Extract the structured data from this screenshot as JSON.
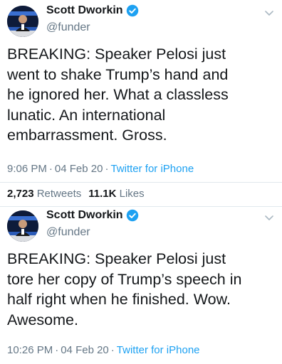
{
  "tweets": [
    {
      "display_name": "Scott Dworkin",
      "handle": "@funder",
      "text": "BREAKING: Speaker Pelosi just\nwent to shake Trump’s hand and\nhe ignored her. What a classless\nlunatic. An international\nembarrassment. Gross.",
      "time": "9:06 PM",
      "date": "04 Feb 20",
      "source": "Twitter for iPhone",
      "retweets": "2,723",
      "retweets_label": "Retweets",
      "likes": "11.1K",
      "likes_label": "Likes"
    },
    {
      "display_name": "Scott Dworkin",
      "handle": "@funder",
      "text": "BREAKING: Speaker Pelosi just\ntore her copy of Trump’s speech in\nhalf right when he finished. Wow.\nAwesome.",
      "time": "10:26 PM",
      "date": "04 Feb 20",
      "source": "Twitter for iPhone"
    }
  ],
  "meta_separator": "·",
  "colors": {
    "verified_badge": "#1da1f2",
    "source_link": "#1da1f2",
    "secondary_text": "#657786"
  },
  "icons": {
    "verified": "verified-badge-icon",
    "menu": "chevron-down-icon"
  }
}
